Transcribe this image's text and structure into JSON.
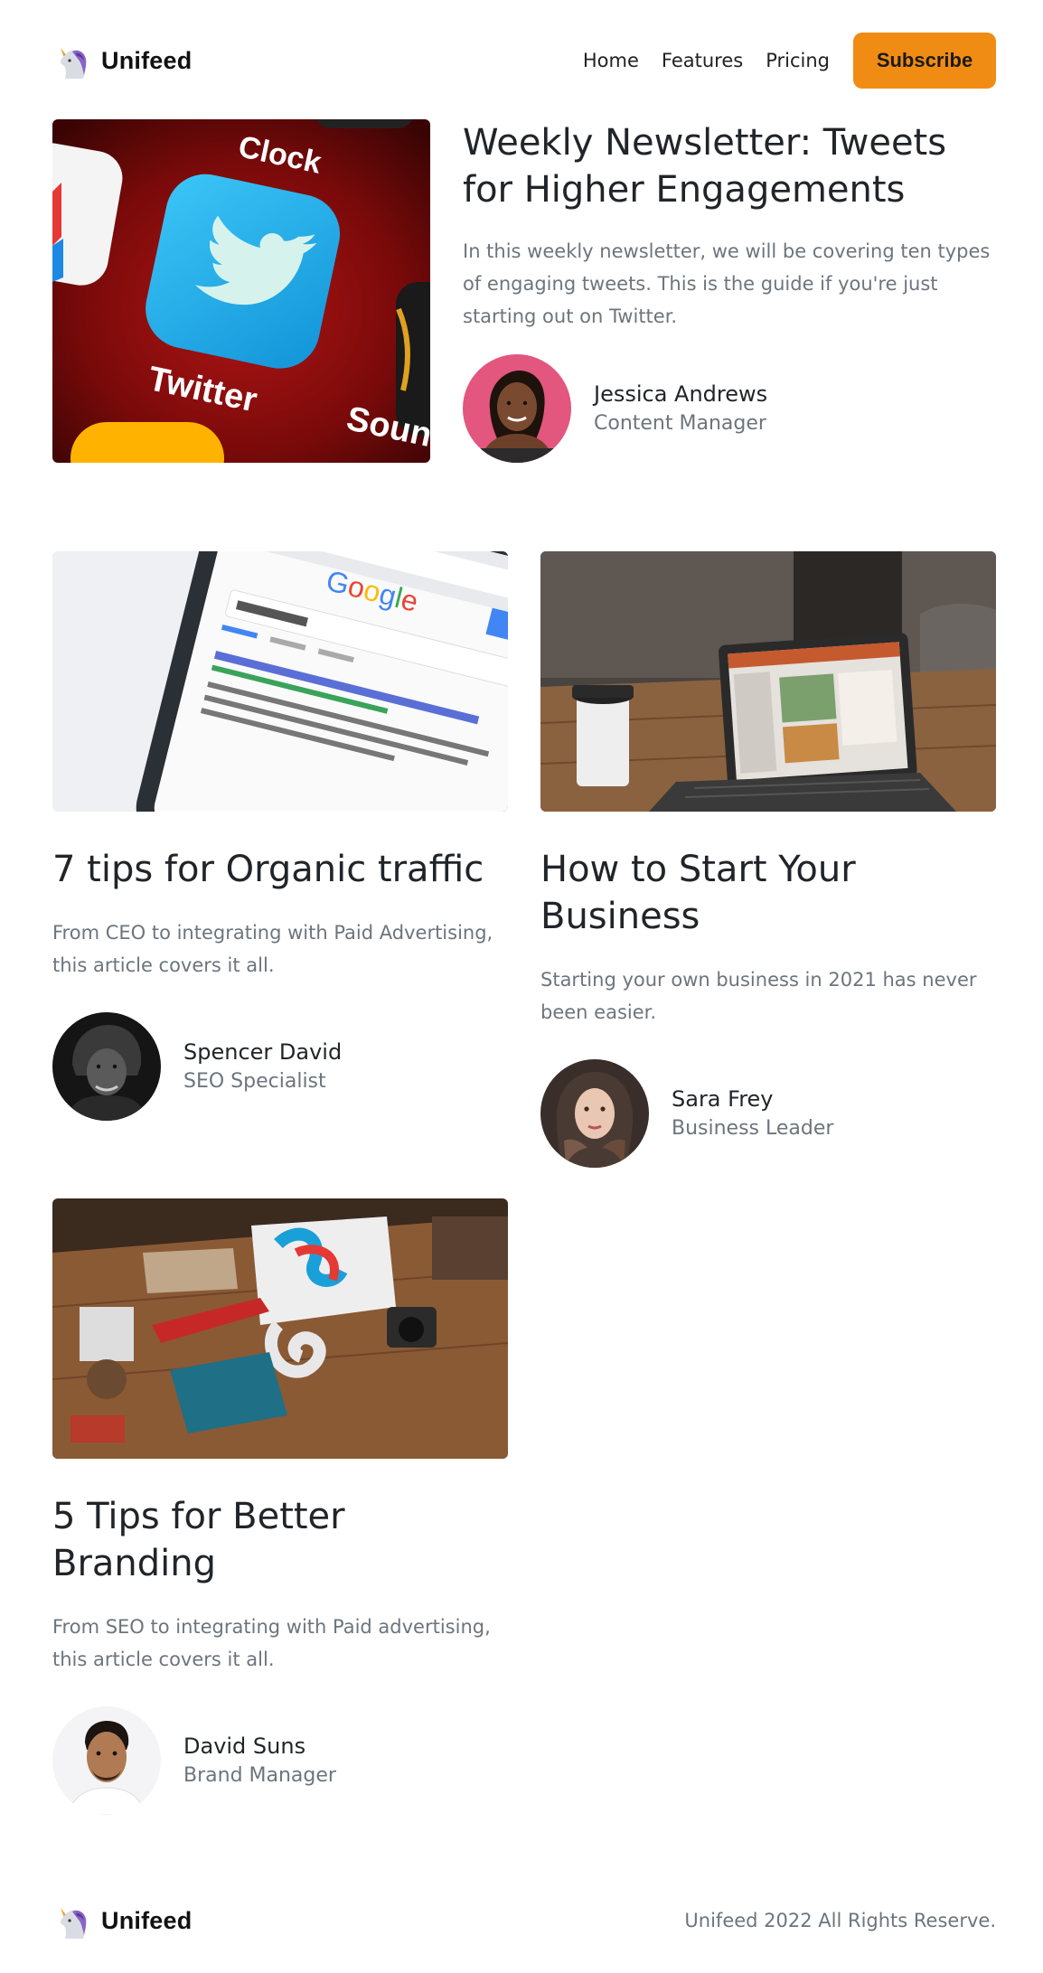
{
  "brand": {
    "name": "Unifeed"
  },
  "nav": {
    "items": [
      "Home",
      "Features",
      "Pricing"
    ],
    "subscribe_label": "Subscribe"
  },
  "featured": {
    "title": "Weekly Newsletter: Tweets for Higher Engagements",
    "description": "In this weekly newsletter, we will be covering ten types of engaging tweets. This is the guide if you're just starting out on Twitter.",
    "image_labels": {
      "top": "Clock",
      "app": "Twitter",
      "bottom": "Soun"
    },
    "author": {
      "name": "Jessica Andrews",
      "role": "Content Manager"
    }
  },
  "articles": [
    {
      "title": "7 tips for Organic traffic",
      "description": "From CEO to integrating with Paid Advertising, this article covers it all.",
      "author": {
        "name": "Spencer David",
        "role": "SEO Specialist"
      }
    },
    {
      "title": "How to Start Your Business",
      "description": "Starting your own business in 2021 has never been easier.",
      "author": {
        "name": "Sara Frey",
        "role": "Business Leader"
      }
    },
    {
      "title": "5 Tips for Better Branding",
      "description": "From SEO to integrating with Paid advertising, this article covers it all.",
      "author": {
        "name": "David Suns",
        "role": "Brand Manager"
      }
    }
  ],
  "footer": {
    "brand": "Unifeed",
    "copyright": "Unifeed 2022 All Rights Reserve."
  },
  "colors": {
    "accent": "#f08c14",
    "text": "#212529",
    "muted": "#6c757d"
  }
}
